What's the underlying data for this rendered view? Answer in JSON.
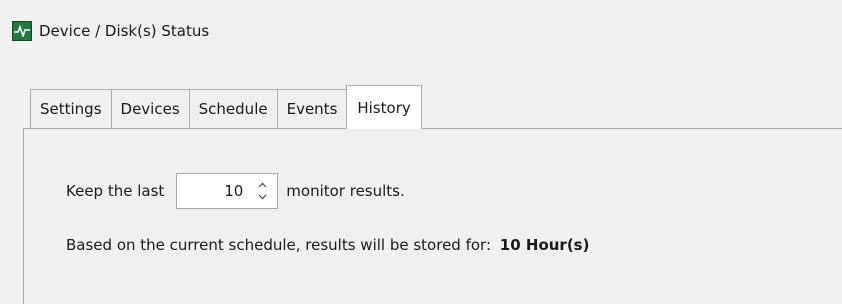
{
  "window": {
    "title": "Device / Disk(s) Status",
    "icon": "monitor-pulse-icon"
  },
  "tabs": [
    {
      "label": "Settings",
      "active": false
    },
    {
      "label": "Devices",
      "active": false
    },
    {
      "label": "Schedule",
      "active": false
    },
    {
      "label": "Events",
      "active": false
    },
    {
      "label": "History",
      "active": true
    }
  ],
  "history": {
    "keep_prefix": "Keep the last",
    "keep_value": "10",
    "keep_suffix": "monitor results.",
    "stored_prefix": "Based on the current schedule, results will be stored for:",
    "stored_value": "10 Hour(s)"
  },
  "colors": {
    "background": "#f0f0f0",
    "icon_green": "#1e7a3e",
    "border": "#acacac"
  }
}
